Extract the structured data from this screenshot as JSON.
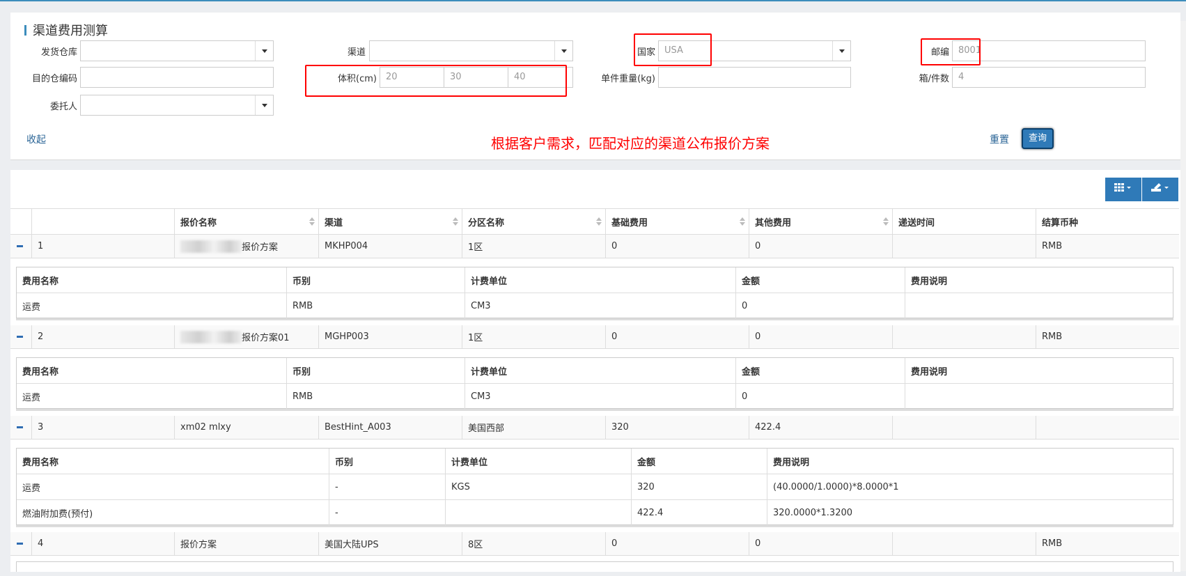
{
  "form": {
    "title": "渠道费用测算",
    "labels": {
      "warehouse": "发货仓库",
      "channel": "渠道",
      "country": "国家",
      "postcode": "邮编",
      "dest_code": "目的仓编码",
      "volume": "体积(cm)",
      "weight": "单件重量(kg)",
      "pieces": "箱/件数",
      "consignor": "委托人"
    },
    "values": {
      "warehouse": "",
      "channel": "",
      "country": "USA",
      "postcode": "8001",
      "dest_code": "",
      "vol_l": "20",
      "vol_w": "30",
      "vol_h": "40",
      "weight": "",
      "pieces": "4",
      "consignor": ""
    },
    "collapse_link": "收起",
    "reset_link": "重置",
    "query_button": "查询",
    "annotation": "根据客户需求，匹配对应的渠道公布报价方案",
    "highlight_color": "#ff0000"
  },
  "toolbar": {
    "columns_icon": "grid-columns-icon",
    "export_icon": "export-icon"
  },
  "grid": {
    "headers": [
      "",
      "",
      "报价名称",
      "渠道",
      "分区名称",
      "基础费用",
      "其他费用",
      "递送时间",
      "结算币种"
    ],
    "detail_headers": [
      "费用名称",
      "币别",
      "计费单位",
      "金额",
      "费用说明"
    ],
    "rows": [
      {
        "index": "1",
        "name": "报价方案",
        "channel": "MKHP004",
        "zone": "1区",
        "base": "0",
        "other": "0",
        "time": "",
        "currency": "RMB",
        "details": [
          {
            "fee": "运费",
            "cur": "RMB",
            "unit": "CM3",
            "amount": "0",
            "desc": ""
          }
        ]
      },
      {
        "index": "2",
        "name": "报价方案01",
        "channel": "MGHP003",
        "zone": "1区",
        "base": "0",
        "other": "0",
        "time": "",
        "currency": "RMB",
        "details": [
          {
            "fee": "运费",
            "cur": "RMB",
            "unit": "CM3",
            "amount": "0",
            "desc": ""
          }
        ]
      },
      {
        "index": "3",
        "name": "xm02 mlxy",
        "channel": "BestHint_A003",
        "zone": "美国西部",
        "base": "320",
        "other": "422.4",
        "time": "",
        "currency": "",
        "details": [
          {
            "fee": "运费",
            "cur": "-",
            "unit": "KGS",
            "amount": "320",
            "desc": "(40.0000/1.0000)*8.0000*1"
          },
          {
            "fee": "燃油附加费(预付)",
            "cur": "-",
            "unit": "",
            "amount": "422.4",
            "desc": "320.0000*1.3200"
          }
        ]
      },
      {
        "index": "4",
        "name": "报价方案",
        "channel": "美国大陆UPS",
        "zone": "8区",
        "base": "0",
        "other": "0",
        "time": "",
        "currency": "RMB",
        "details": []
      }
    ]
  }
}
